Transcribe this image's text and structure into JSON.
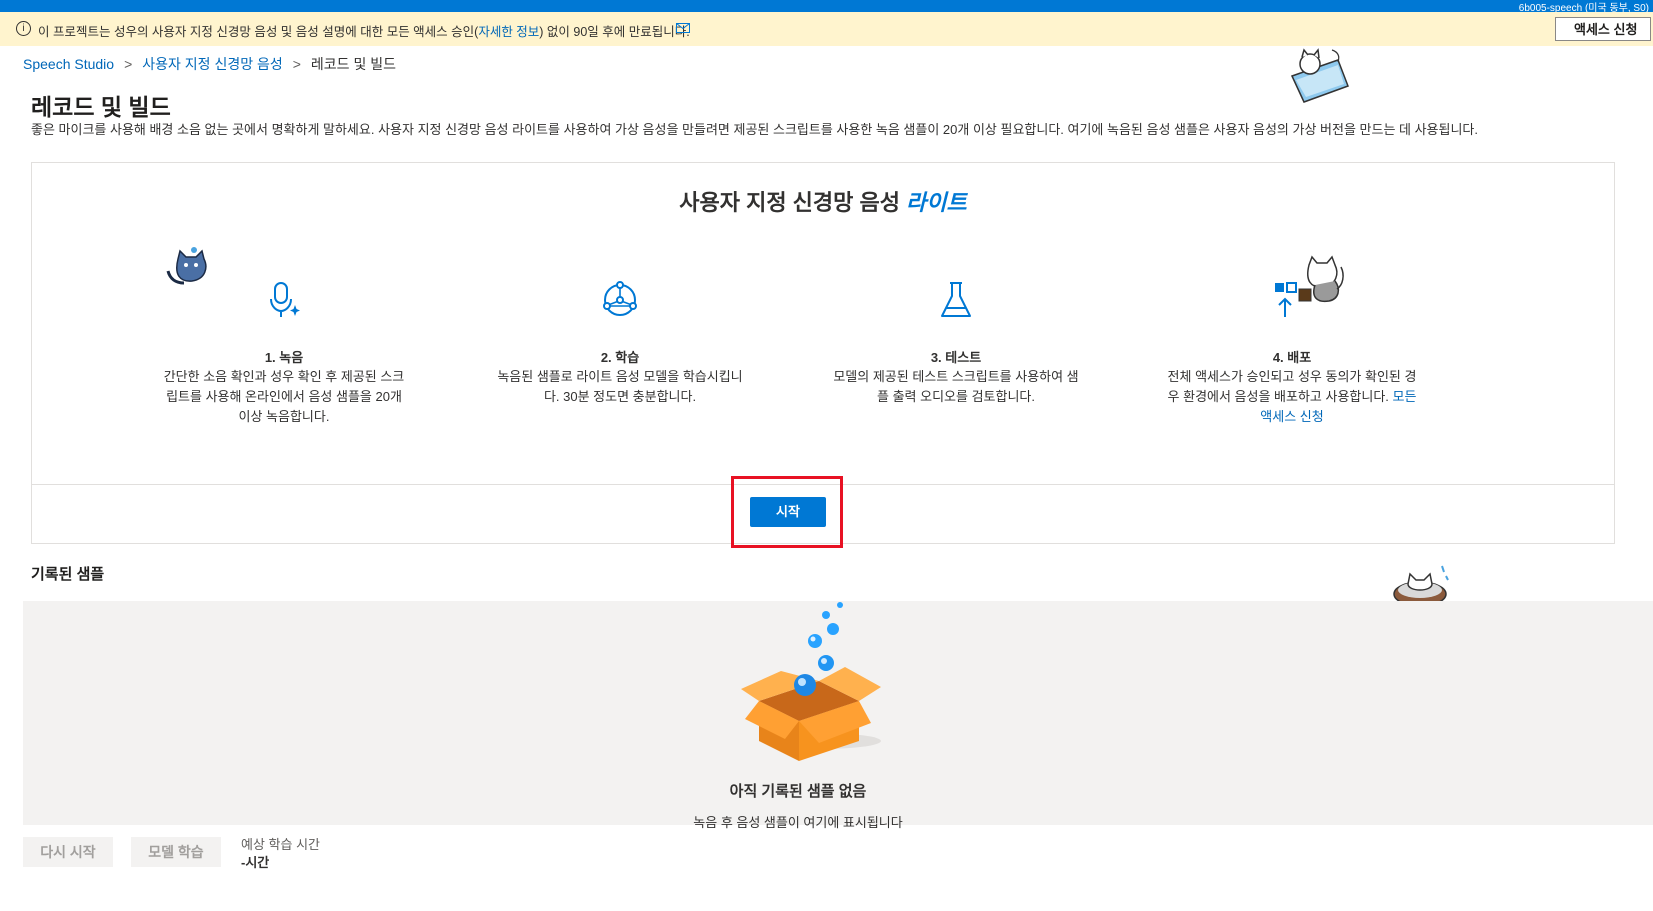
{
  "top_bar": {
    "resource_label": "6b005-speech (미국 동부, S0)"
  },
  "banner": {
    "text_before_link": "이 프로젝트는 성우의 사용자 지정 신경망 음성 및 음성 설명에 대한 모든 액세스 승인(",
    "link": "자세한 정보",
    "text_after_link": ") 없이 90일 후에 만료됩니다.",
    "access_button": "액세스 신청"
  },
  "breadcrumb": {
    "items": [
      "Speech Studio",
      "사용자 지정 신경망 음성",
      "레코드 및 빌드"
    ],
    "separator": ">"
  },
  "page": {
    "title": "레코드 및 빌드",
    "description": "좋은 마이크를 사용해 배경 소음 없는 곳에서 명확하게 말하세요. 사용자 지정 신경망 음성 라이트를 사용하여 가상 음성을 만들려면 제공된 스크립트를 사용한 녹음 샘플이 20개 이상 필요합니다. 여기에 녹음된 음성 샘플은 사용자 음성의 가상 버전을 만드는 데 사용됩니다."
  },
  "card": {
    "title": "사용자 지정 신경망 음성",
    "title_accent": "라이트",
    "steps": [
      {
        "title": "1. 녹음",
        "desc": "간단한 소음 확인과 성우 확인 후 제공된 스크립트를 사용해 온라인에서 음성 샘플을 20개 이상 녹음합니다.",
        "icon": "microphone-sparkle-icon"
      },
      {
        "title": "2. 학습",
        "desc": "녹음된 샘플로 라이트 음성 모델을 학습시킵니다. 30분 정도면 충분합니다.",
        "icon": "network-icon"
      },
      {
        "title": "3. 테스트",
        "desc": "모델의 제공된 테스트 스크립트를 사용하여 샘플 출력 오디오를 검토합니다.",
        "icon": "flask-icon"
      },
      {
        "title": "4. 배포",
        "desc": "전체 액세스가 승인되고 성우 동의가 확인된 경우 환경에서 음성을 배포하고 사용합니다.",
        "link": "모든 액세스 신청",
        "icon": "deploy-icon"
      }
    ],
    "start_button": "시작"
  },
  "samples": {
    "section_title": "기록된 샘플",
    "empty_title": "아직 기록된 샘플 없음",
    "empty_subtitle": "녹음 후 음성 샘플이 여기에 표시됩니다"
  },
  "footer": {
    "restart_button": "다시 시작",
    "train_button": "모델 학습",
    "estimate_label": "예상 학습 시간",
    "estimate_value": "-시간"
  },
  "colors": {
    "accent": "#0078d4",
    "banner_bg": "#fff4ce",
    "highlight": "#e81123",
    "box": "#f7931e"
  }
}
